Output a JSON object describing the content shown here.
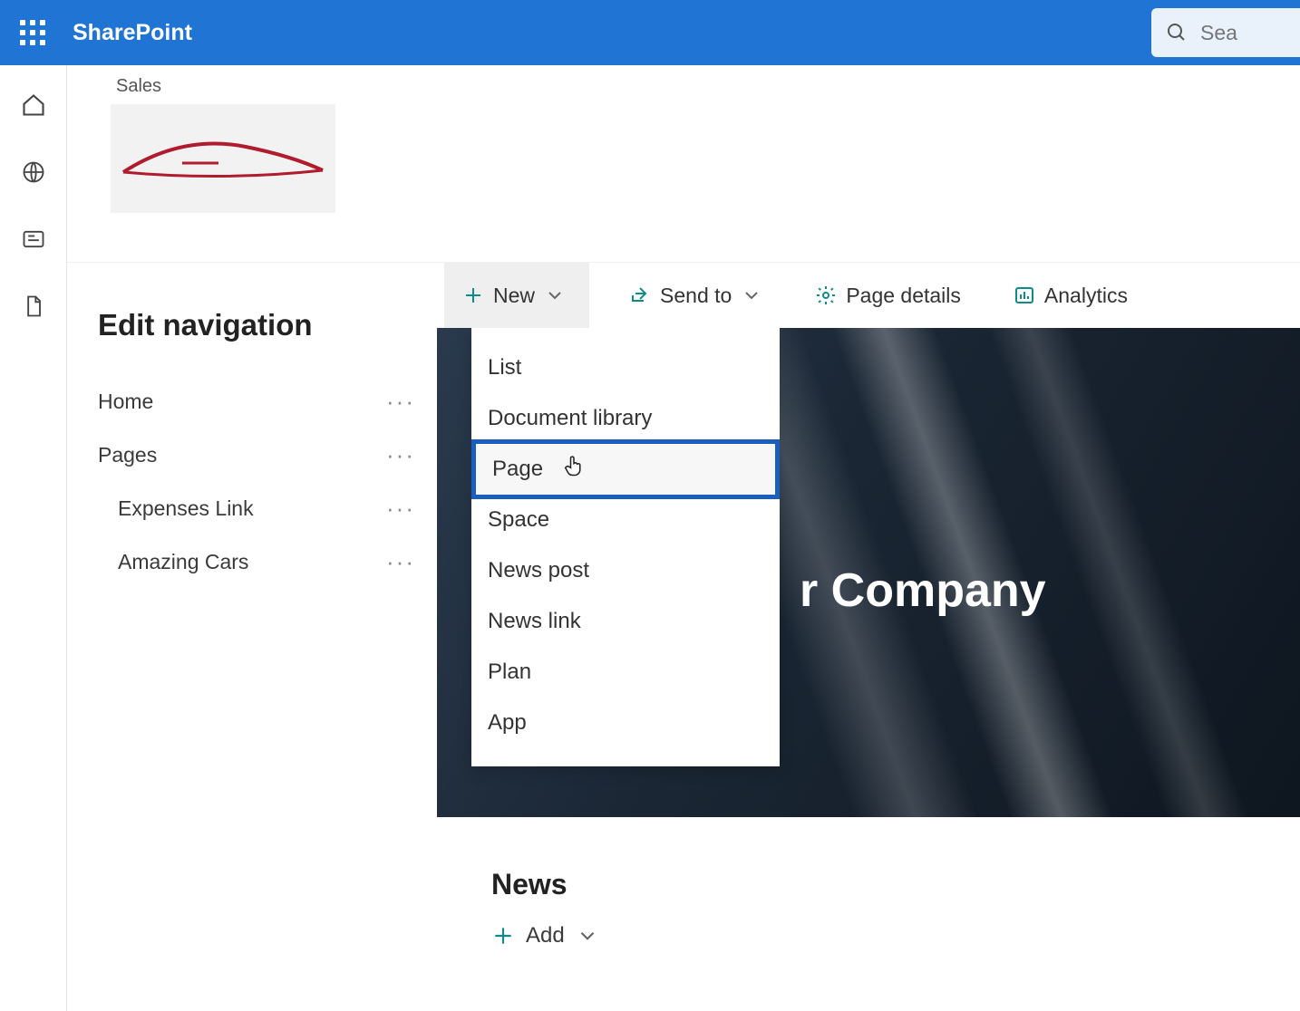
{
  "suite": {
    "app_title": "SharePoint",
    "search_placeholder": "Sea"
  },
  "site": {
    "name": "Sales"
  },
  "edit_nav": {
    "title": "Edit navigation",
    "items": [
      {
        "label": "Home",
        "child": false
      },
      {
        "label": "Pages",
        "child": false
      },
      {
        "label": "Expenses Link",
        "child": true
      },
      {
        "label": "Amazing Cars",
        "child": true
      }
    ]
  },
  "commands": {
    "new_label": "New",
    "send_to_label": "Send to",
    "page_details_label": "Page details",
    "analytics_label": "Analytics"
  },
  "new_menu": {
    "items": [
      "List",
      "Document library",
      "Page",
      "Space",
      "News post",
      "News link",
      "Plan",
      "App"
    ],
    "highlight_index": 2
  },
  "hero": {
    "title_fragment": "r Company"
  },
  "news": {
    "heading": "News",
    "add_label": "Add"
  },
  "colors": {
    "primary": "#2074d4",
    "teal": "#0f8b8b"
  }
}
